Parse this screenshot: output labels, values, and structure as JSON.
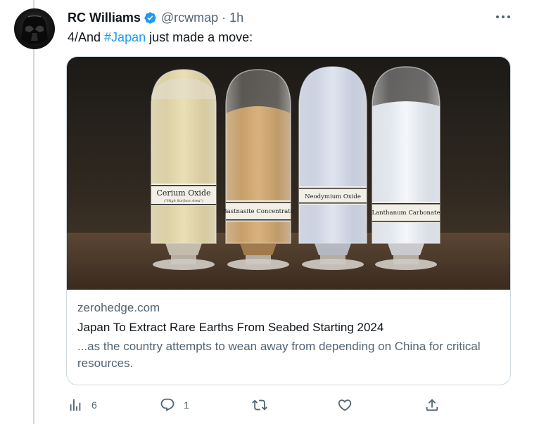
{
  "tweet": {
    "display_name": "RC Williams",
    "handle": "@rcwmap",
    "separator": "·",
    "time": "1h",
    "text_prefix": "4/And ",
    "hashtag": "#Japan",
    "text_suffix": " just made a move:"
  },
  "card": {
    "domain": "zerohedge.com",
    "title": "Japan To Extract Rare Earths From Seabed Starting 2024",
    "description": "...as the country attempts to wean away from depending on China for critical resources.",
    "image_labels": {
      "vial1": "Cerium Oxide",
      "vial1_sub": "(\"High Surface Area\")",
      "vial2": "Bastnasite Concentrate",
      "vial3": "Neodymium Oxide",
      "vial4": "Lanthanum Carbonate"
    }
  },
  "actions": {
    "views_count": "6",
    "replies_count": "1"
  },
  "icons": [
    "verified-icon",
    "more-icon",
    "views-icon",
    "reply-icon",
    "retweet-icon",
    "like-icon",
    "share-icon"
  ],
  "colors": {
    "accent": "#1d9bf0",
    "secondary_text": "#536471",
    "border": "#cfd9de"
  }
}
